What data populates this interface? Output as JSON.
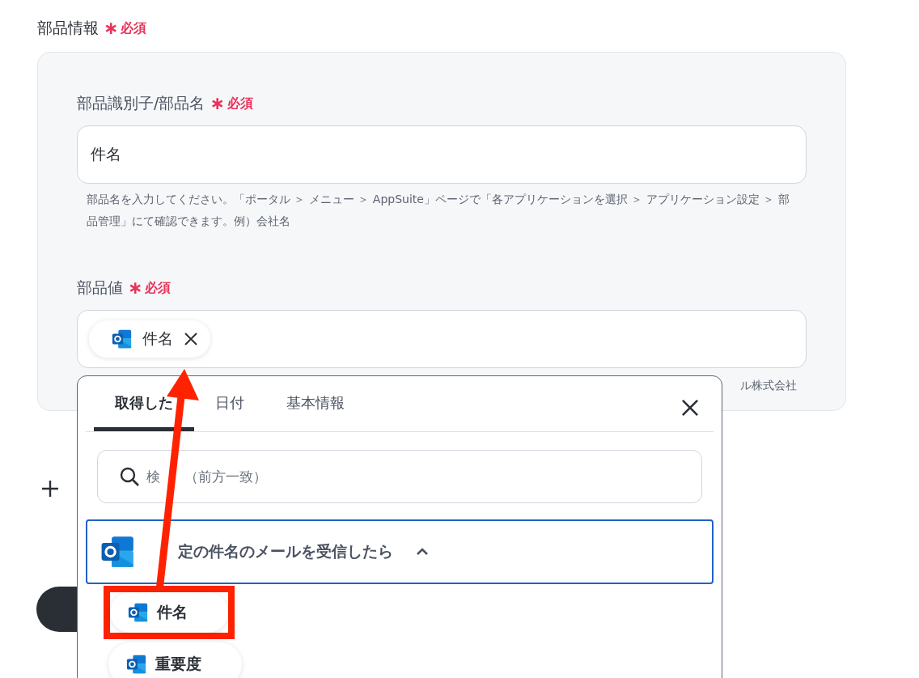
{
  "section": {
    "title": "部品情報",
    "mark": "∗",
    "required": "必須"
  },
  "fields": [
    {
      "kind": "text",
      "label": "部品識別子/部品名",
      "mark": "∗",
      "required": "必須",
      "value": "件名",
      "help": "部品名を入力してください。「ポータル ＞ メニュー ＞ AppSuite」ページで「各アプリケーションを選択 ＞ アプリケーション設定 ＞ 部品管理」にて確認できます。例）会社名"
    },
    {
      "kind": "chips",
      "label": "部品値",
      "mark": "∗",
      "required": "必須",
      "chips": [
        "件名"
      ],
      "help": "ル株式会社"
    }
  ],
  "dropdown": {
    "tabs": [
      {
        "label": "取得した",
        "selected": true
      },
      {
        "label": "日付",
        "selected": false
      },
      {
        "label": "基本情報",
        "selected": false
      }
    ],
    "search": {
      "placeholder": [
        "検",
        "（前方一致）"
      ]
    },
    "group": {
      "title": "定の件名のメールを受信したら",
      "expanded": true
    },
    "items": [
      {
        "label": "件名",
        "annotated": true
      },
      {
        "label": "重要度",
        "annotated": false
      }
    ]
  }
}
